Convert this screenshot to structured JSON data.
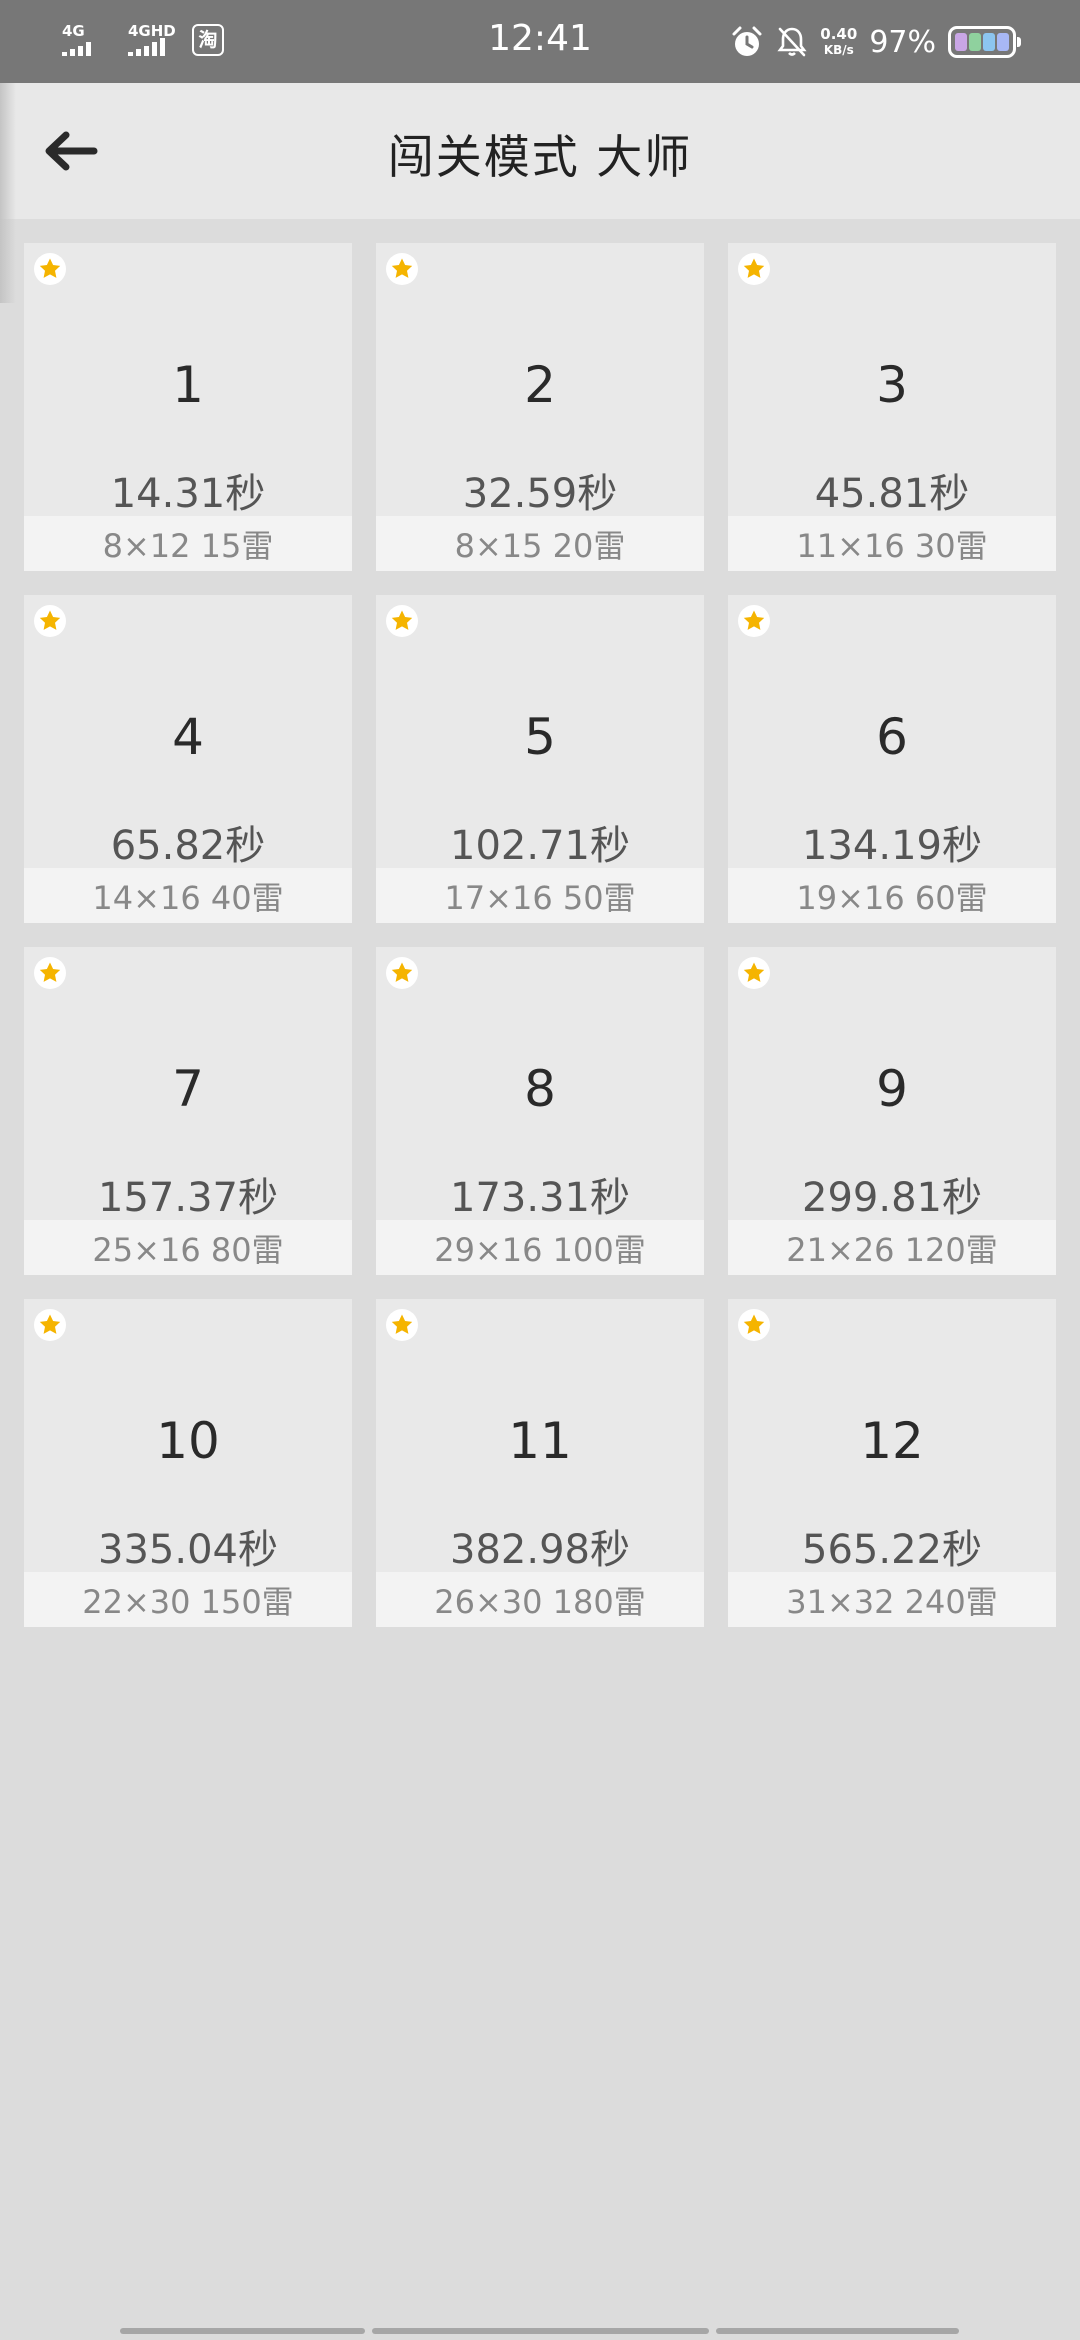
{
  "status_bar": {
    "time": "12:41",
    "signal1_label": "4G",
    "signal2_label": "4GHD",
    "app_icon_char": "淘",
    "net_speed_value": "0.40",
    "net_speed_unit": "KB/s",
    "battery_percent": "97%",
    "battery_colors": [
      "#c9a6e6",
      "#8fd19e",
      "#8cc5f0",
      "#a8b8f5"
    ],
    "icons": [
      "alarm-icon",
      "bell-off-icon",
      "battery-icon"
    ]
  },
  "header": {
    "title": "闯关模式 大师",
    "back_icon": "arrow-left-icon"
  },
  "accent_color": "#f5b400",
  "levels": [
    {
      "number": "1",
      "time": "14.31秒",
      "info": "8×12  15雷"
    },
    {
      "number": "2",
      "time": "32.59秒",
      "info": "8×15  20雷"
    },
    {
      "number": "3",
      "time": "45.81秒",
      "info": "11×16  30雷"
    },
    {
      "number": "4",
      "time": "65.82秒",
      "info": "14×16  40雷"
    },
    {
      "number": "5",
      "time": "102.71秒",
      "info": "17×16  50雷"
    },
    {
      "number": "6",
      "time": "134.19秒",
      "info": "19×16  60雷"
    },
    {
      "number": "7",
      "time": "157.37秒",
      "info": "25×16  80雷"
    },
    {
      "number": "8",
      "time": "173.31秒",
      "info": "29×16  100雷"
    },
    {
      "number": "9",
      "time": "299.81秒",
      "info": "21×26  120雷"
    },
    {
      "number": "10",
      "time": "335.04秒",
      "info": "22×30  150雷"
    },
    {
      "number": "11",
      "time": "382.98秒",
      "info": "26×30  180雷"
    },
    {
      "number": "12",
      "time": "565.22秒",
      "info": "31×32  240雷"
    }
  ]
}
